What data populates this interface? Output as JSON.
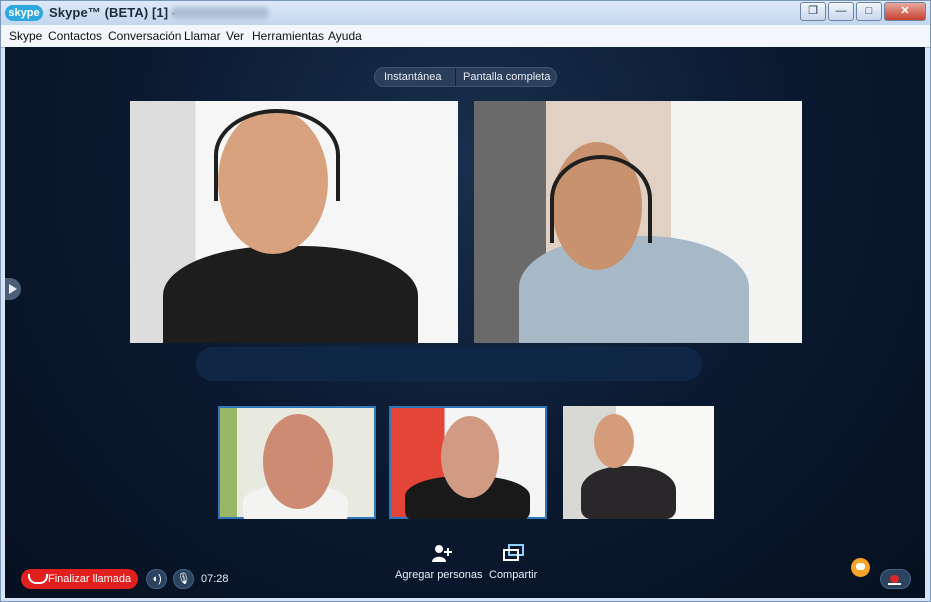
{
  "window": {
    "title": "Skype™ (BETA) [1] -",
    "logo": "skype",
    "controls": [
      "restore-icon",
      "minimize-icon",
      "maximize-icon",
      "close-icon"
    ]
  },
  "menu": [
    "Skype",
    "Contactos",
    "Conversación",
    "Llamar",
    "Ver",
    "Herramientas",
    "Ayuda"
  ],
  "view_toggle": {
    "snapshot": "Instantánea",
    "fullscreen": "Pantalla completa"
  },
  "actions": {
    "add_people": "Agregar personas",
    "share": "Compartir"
  },
  "call": {
    "end_label": "Finalizar llamada",
    "duration": "07:28"
  },
  "colors": {
    "end_call": "#e11f1f",
    "accent": "#2f77b8",
    "chat": "#f6a42a"
  }
}
